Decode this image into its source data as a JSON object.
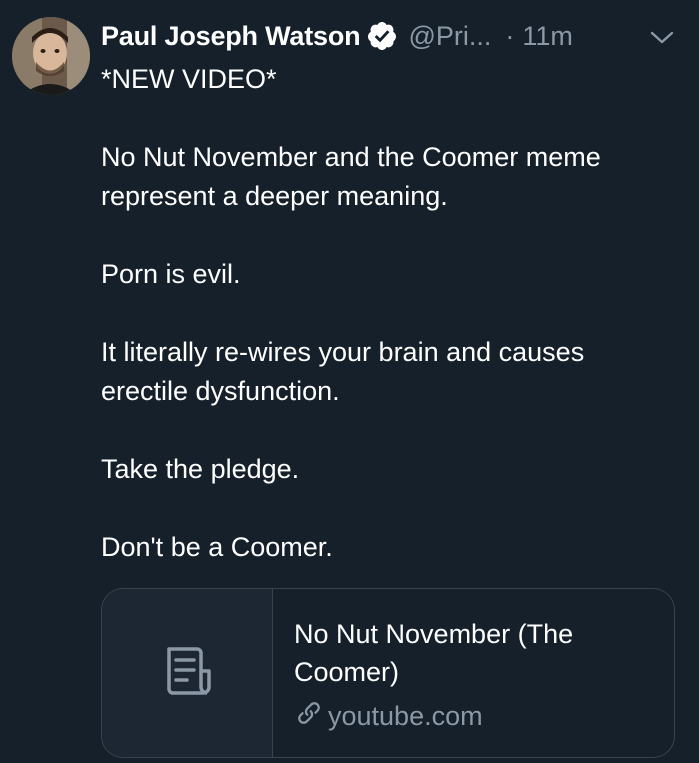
{
  "tweet": {
    "author": {
      "display_name": "Paul Joseph Watson",
      "handle": "@Pri...",
      "verified": true,
      "avatar_icon": "profile-photo"
    },
    "separator": "·",
    "time": "11m",
    "menu_icon": "chevron-down-icon",
    "paragraphs": [
      "*NEW VIDEO*",
      "No Nut November and the Coomer meme represent a deeper meaning.",
      "Porn is evil.",
      "It literally re-wires your brain and causes erectile dysfunction.",
      "Take the pledge.",
      "Don't be a Coomer."
    ],
    "card": {
      "thumb_icon": "document-icon",
      "title": "No Nut November (The Coomer)",
      "link_icon": "link-icon",
      "domain": "youtube.com"
    }
  },
  "colors": {
    "background": "#15202b",
    "primary_text": "#ffffff",
    "secondary_text": "#8b98a5",
    "border": "#38444d",
    "card_thumb_bg": "#1c2733"
  }
}
